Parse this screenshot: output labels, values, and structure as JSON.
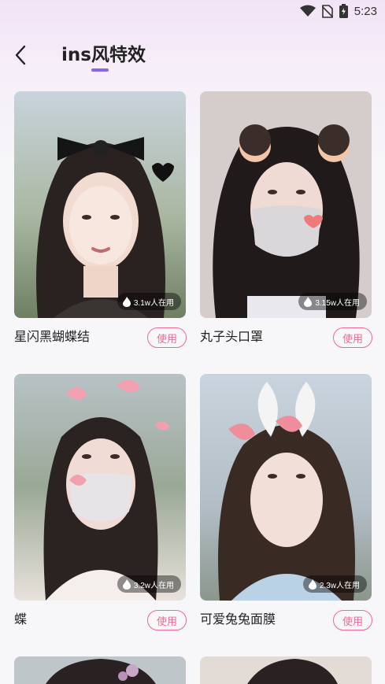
{
  "status_bar": {
    "time": "5:23",
    "icons": [
      "wifi-icon",
      "no-sim-icon",
      "battery-icon"
    ]
  },
  "header": {
    "title": "ins风特效",
    "back_icon": "chevron-left-icon",
    "accent_color": "#8b67e8"
  },
  "effects": [
    {
      "name": "星闪黑蝴蝶结",
      "usage": "3.1w人在用",
      "action": "使用"
    },
    {
      "name": "丸子头口罩",
      "usage": "3.15w人在用",
      "action": "使用"
    },
    {
      "name": "蝶",
      "usage": "3.2w人在用",
      "action": "使用"
    },
    {
      "name": "可爱兔兔面膜",
      "usage": "2.3w人在用",
      "action": "使用"
    }
  ],
  "colors": {
    "use_button": "#ec6b92",
    "badge_bg": "rgba(0,0,0,0.42)"
  }
}
